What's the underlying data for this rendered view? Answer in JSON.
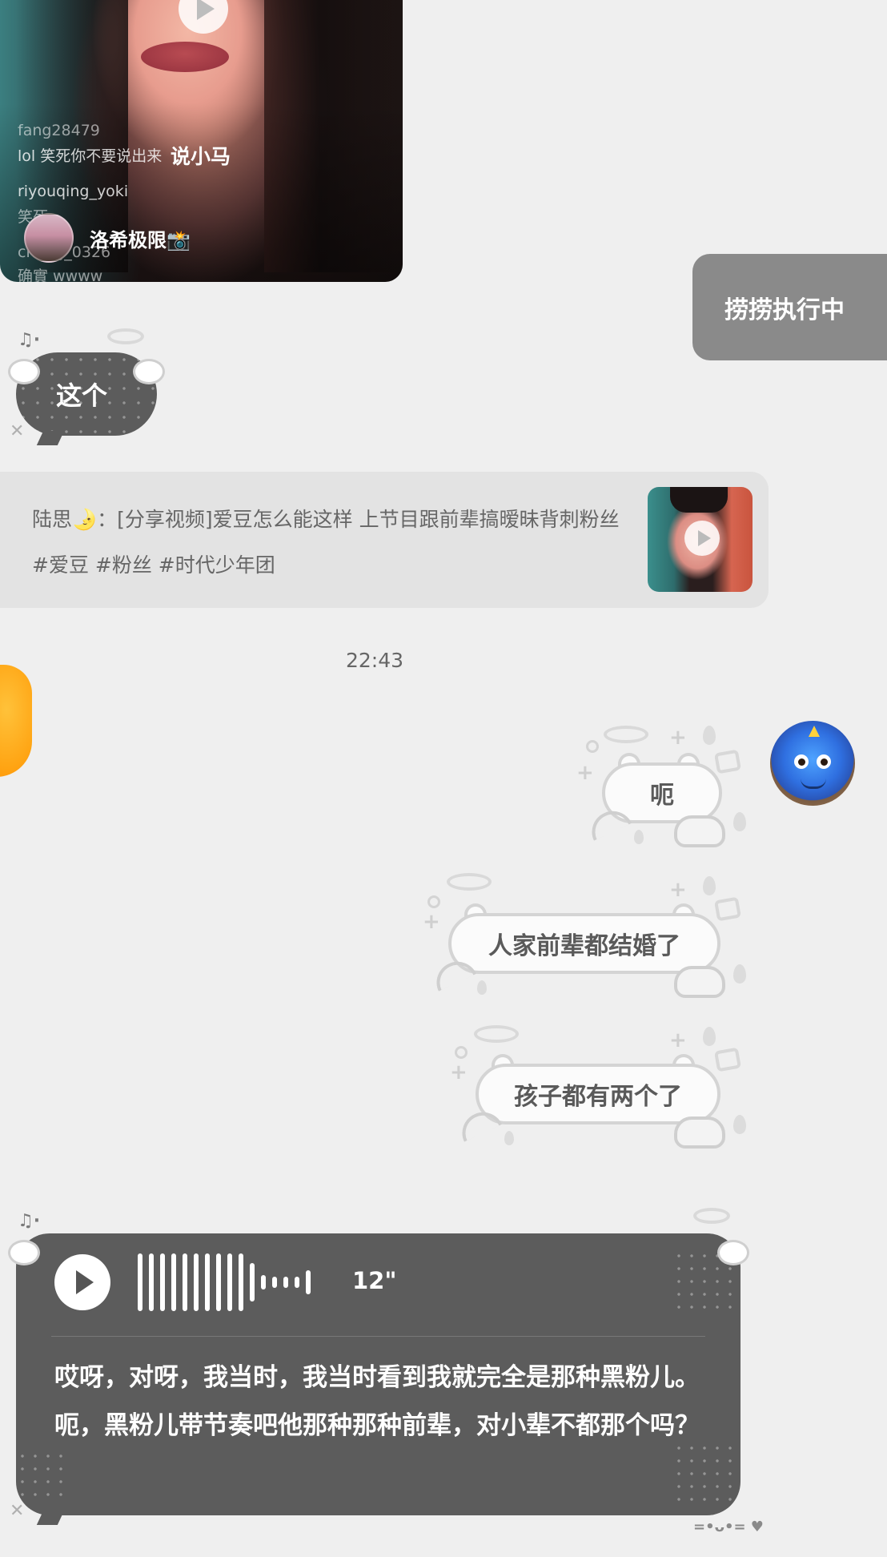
{
  "colors": {
    "background": "#efefef",
    "gray_bubble": "#8a8a8a",
    "dark_bubble": "#5c5c5c",
    "share_card": "#e3e3e3"
  },
  "video_message": {
    "comments": [
      {
        "user": "fang28479",
        "text": "lol 笑死你不要说出来"
      },
      {
        "user": "riyouqing_yoki",
        "text": "笑死"
      },
      {
        "user": "cheng_0326",
        "text": "确實 wwww"
      }
    ],
    "overlay_caption": "说小马",
    "creator_name": "洛希极限📸",
    "icon": "play-icon"
  },
  "sent_text_1": "捞捞执行中",
  "received_text_1": "这个",
  "share": {
    "sender": "陆思",
    "emoji": "🌛",
    "text": "：[分享视频]爱豆怎么能这样  上节目跟前辈搞暧昧背刺粉丝#爱豆  #粉丝  #时代少年团",
    "thumbnail_icon": "play-icon"
  },
  "timestamp": "22:43",
  "sent_messages": [
    {
      "text": "呃"
    },
    {
      "text": "人家前辈都结婚了"
    },
    {
      "text": "孩子都有两个了"
    }
  ],
  "voice_message": {
    "duration": "12\"",
    "transcript": "哎呀，对呀，我当时，我当时看到我就完全是那种黑粉儿。呃，黑粉儿带节奏吧他那种那种前辈，对小辈不都那个吗？",
    "icon": "play-icon"
  },
  "avatar_icon": "blue-creature-avatar"
}
